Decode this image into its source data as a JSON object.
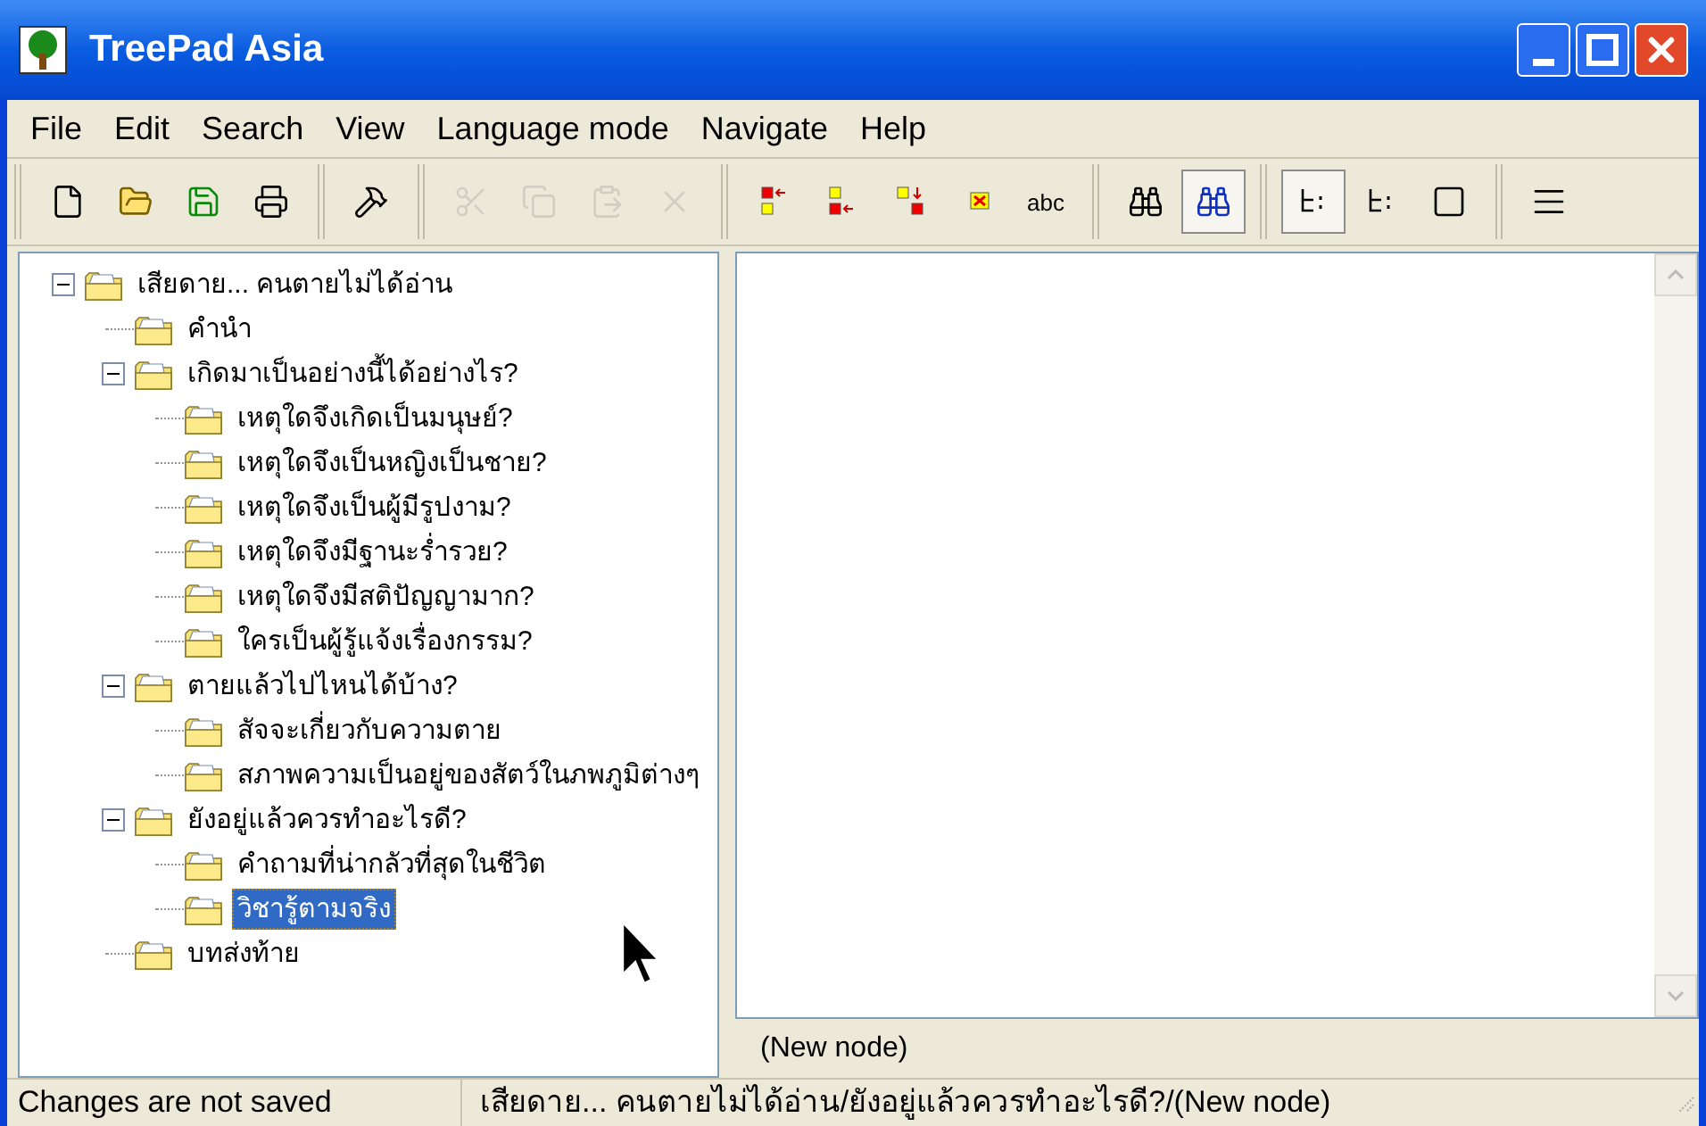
{
  "window": {
    "title": "TreePad Asia"
  },
  "menu": [
    "File",
    "Edit",
    "Search",
    "View",
    "Language mode",
    "Navigate",
    "Help"
  ],
  "toolbar": [
    [
      {
        "kind": "new",
        "disabled": false,
        "pressed": false
      },
      {
        "kind": "open",
        "disabled": false,
        "pressed": false
      },
      {
        "kind": "save",
        "disabled": false,
        "pressed": false
      },
      {
        "kind": "print",
        "disabled": false,
        "pressed": false
      }
    ],
    [
      {
        "kind": "tools",
        "disabled": false,
        "pressed": false
      }
    ],
    [
      {
        "kind": "cut",
        "disabled": true,
        "pressed": false
      },
      {
        "kind": "copy",
        "disabled": true,
        "pressed": false
      },
      {
        "kind": "paste",
        "disabled": true,
        "pressed": false
      },
      {
        "kind": "delete",
        "disabled": true,
        "pressed": false
      }
    ],
    [
      {
        "kind": "insert-before",
        "disabled": false,
        "pressed": false
      },
      {
        "kind": "insert-after",
        "disabled": false,
        "pressed": false
      },
      {
        "kind": "insert-child",
        "disabled": false,
        "pressed": false
      },
      {
        "kind": "remove-node",
        "disabled": false,
        "pressed": false
      },
      {
        "kind": "rename",
        "label": "abc",
        "disabled": false,
        "pressed": false
      }
    ],
    [
      {
        "kind": "find",
        "disabled": false,
        "pressed": false
      },
      {
        "kind": "find-node",
        "disabled": false,
        "pressed": true
      }
    ],
    [
      {
        "kind": "tree-view",
        "disabled": false,
        "pressed": true
      },
      {
        "kind": "tree-view-plain",
        "disabled": false,
        "pressed": false
      },
      {
        "kind": "blank",
        "disabled": false,
        "pressed": false
      }
    ],
    [
      {
        "kind": "list",
        "disabled": false,
        "pressed": false
      }
    ]
  ],
  "tree": [
    {
      "label": "เสียดาย... คนตายไม่ได้อ่าน",
      "expanded": true,
      "selected": false,
      "children": [
        {
          "label": "คำนำ",
          "selected": false
        },
        {
          "label": "เกิดมาเป็นอย่างนี้ได้อย่างไร?",
          "expanded": true,
          "selected": false,
          "children": [
            {
              "label": "เหตุใดจึงเกิดเป็นมนุษย์?",
              "selected": false
            },
            {
              "label": "เหตุใดจึงเป็นหญิงเป็นชาย?",
              "selected": false
            },
            {
              "label": "เหตุใดจึงเป็นผู้มีรูปงาม?",
              "selected": false
            },
            {
              "label": "เหตุใดจึงมีฐานะร่ำรวย?",
              "selected": false
            },
            {
              "label": "เหตุใดจึงมีสติปัญญามาก?",
              "selected": false
            },
            {
              "label": "ใครเป็นผู้รู้แจ้งเรื่องกรรม?",
              "selected": false
            }
          ]
        },
        {
          "label": "ตายแล้วไปไหนได้บ้าง?",
          "expanded": true,
          "selected": false,
          "children": [
            {
              "label": "สัจจะเกี่ยวกับความตาย",
              "selected": false
            },
            {
              "label": "สภาพความเป็นอยู่ของสัตว์ในภพภูมิต่างๆ",
              "selected": false
            }
          ]
        },
        {
          "label": "ยังอยู่แล้วควรทำอะไรดี?",
          "expanded": true,
          "selected": false,
          "children": [
            {
              "label": "คำถามที่น่ากลัวที่สุดในชีวิต",
              "selected": false
            },
            {
              "label": "วิชารู้ตามจริง",
              "selected": true
            }
          ]
        },
        {
          "label": "บทส่งท้าย",
          "selected": false
        }
      ]
    }
  ],
  "editor": {
    "node_title": "(New node)"
  },
  "status_bar": [
    "Changes are not saved",
    "เสียดาย... คนตายไม่ได้อ่าน/ยังอยู่แล้วควรทำอะไรดี?/(New node)"
  ]
}
